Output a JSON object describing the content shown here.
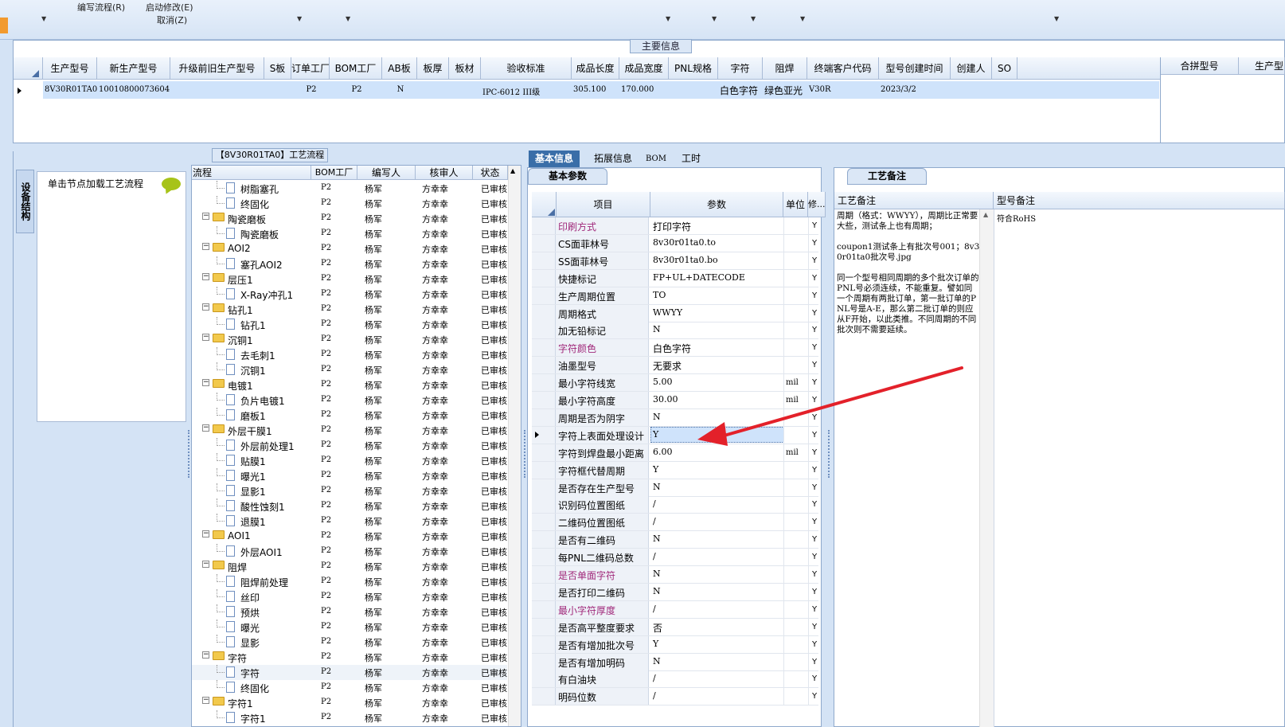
{
  "toolbar": {
    "write_flow": "编写流程(R)",
    "start_modify": "启动修改(E)",
    "cancel": "取消(Z)"
  },
  "main_info": {
    "title": "主要信息",
    "columns": [
      "生产型号",
      "新生产型号",
      "升级前旧生产型号",
      "S板",
      "订单工厂",
      "BOM工厂",
      "AB板",
      "板厚",
      "板材",
      "验收标准",
      "成品长度",
      "成品宽度",
      "PNL规格",
      "字符",
      "阻焊",
      "终端客户代码",
      "型号创建时间",
      "创建人",
      "SO"
    ],
    "row": [
      "8V30R01TA0",
      "10010800073604",
      "",
      "",
      "P2",
      "P2",
      "N",
      "",
      "",
      "IPC-6012 III级",
      "305.100",
      "170.000",
      "",
      "白色字符",
      "绿色亚光",
      "V30R",
      "2023/3/2",
      "",
      ""
    ],
    "merge_columns": [
      "合拼型号",
      "生产型"
    ]
  },
  "nav": {
    "vertical_tab": "设备结构",
    "hint": "单击节点加载工艺流程"
  },
  "tree": {
    "title": "【8V30R01TA0】工艺流程",
    "columns": [
      "流程",
      "BOM工厂",
      "编写人",
      "核审人",
      "状态"
    ],
    "rows": [
      {
        "level": 2,
        "type": "file",
        "name": "树脂塞孔",
        "bom": "P2",
        "writer": "杨军",
        "reviewer": "方幸幸",
        "status": "已审核"
      },
      {
        "level": 2,
        "type": "file",
        "name": "终固化",
        "bom": "P2",
        "writer": "杨军",
        "reviewer": "方幸幸",
        "status": "已审核"
      },
      {
        "level": 1,
        "type": "folder",
        "name": "陶瓷磨板",
        "bom": "P2",
        "writer": "杨军",
        "reviewer": "方幸幸",
        "status": "已审核"
      },
      {
        "level": 2,
        "type": "file",
        "name": "陶瓷磨板",
        "bom": "P2",
        "writer": "杨军",
        "reviewer": "方幸幸",
        "status": "已审核"
      },
      {
        "level": 1,
        "type": "folder",
        "name": "AOI2",
        "bom": "P2",
        "writer": "杨军",
        "reviewer": "方幸幸",
        "status": "已审核"
      },
      {
        "level": 2,
        "type": "file",
        "name": "塞孔AOI2",
        "bom": "P2",
        "writer": "杨军",
        "reviewer": "方幸幸",
        "status": "已审核"
      },
      {
        "level": 1,
        "type": "folder",
        "name": "层压1",
        "bom": "P2",
        "writer": "杨军",
        "reviewer": "方幸幸",
        "status": "已审核"
      },
      {
        "level": 2,
        "type": "file",
        "name": "X-Ray冲孔1",
        "bom": "P2",
        "writer": "杨军",
        "reviewer": "方幸幸",
        "status": "已审核"
      },
      {
        "level": 1,
        "type": "folder",
        "name": "钻孔1",
        "bom": "P2",
        "writer": "杨军",
        "reviewer": "方幸幸",
        "status": "已审核"
      },
      {
        "level": 2,
        "type": "file",
        "name": "钻孔1",
        "bom": "P2",
        "writer": "杨军",
        "reviewer": "方幸幸",
        "status": "已审核"
      },
      {
        "level": 1,
        "type": "folder",
        "name": "沉铜1",
        "bom": "P2",
        "writer": "杨军",
        "reviewer": "方幸幸",
        "status": "已审核"
      },
      {
        "level": 2,
        "type": "file",
        "name": "去毛刺1",
        "bom": "P2",
        "writer": "杨军",
        "reviewer": "方幸幸",
        "status": "已审核"
      },
      {
        "level": 2,
        "type": "file",
        "name": "沉铜1",
        "bom": "P2",
        "writer": "杨军",
        "reviewer": "方幸幸",
        "status": "已审核"
      },
      {
        "level": 1,
        "type": "folder",
        "name": "电镀1",
        "bom": "P2",
        "writer": "杨军",
        "reviewer": "方幸幸",
        "status": "已审核"
      },
      {
        "level": 2,
        "type": "file",
        "name": "负片电镀1",
        "bom": "P2",
        "writer": "杨军",
        "reviewer": "方幸幸",
        "status": "已审核"
      },
      {
        "level": 2,
        "type": "file",
        "name": "磨板1",
        "bom": "P2",
        "writer": "杨军",
        "reviewer": "方幸幸",
        "status": "已审核"
      },
      {
        "level": 1,
        "type": "folder",
        "name": "外层干膜1",
        "bom": "P2",
        "writer": "杨军",
        "reviewer": "方幸幸",
        "status": "已审核"
      },
      {
        "level": 2,
        "type": "file",
        "name": "外层前处理1",
        "bom": "P2",
        "writer": "杨军",
        "reviewer": "方幸幸",
        "status": "已审核"
      },
      {
        "level": 2,
        "type": "file",
        "name": "贴膜1",
        "bom": "P2",
        "writer": "杨军",
        "reviewer": "方幸幸",
        "status": "已审核"
      },
      {
        "level": 2,
        "type": "file",
        "name": "曝光1",
        "bom": "P2",
        "writer": "杨军",
        "reviewer": "方幸幸",
        "status": "已审核"
      },
      {
        "level": 2,
        "type": "file",
        "name": "显影1",
        "bom": "P2",
        "writer": "杨军",
        "reviewer": "方幸幸",
        "status": "已审核"
      },
      {
        "level": 2,
        "type": "file",
        "name": "酸性蚀刻1",
        "bom": "P2",
        "writer": "杨军",
        "reviewer": "方幸幸",
        "status": "已审核"
      },
      {
        "level": 2,
        "type": "file",
        "name": "退膜1",
        "bom": "P2",
        "writer": "杨军",
        "reviewer": "方幸幸",
        "status": "已审核"
      },
      {
        "level": 1,
        "type": "folder",
        "name": "AOI1",
        "bom": "P2",
        "writer": "杨军",
        "reviewer": "方幸幸",
        "status": "已审核"
      },
      {
        "level": 2,
        "type": "file",
        "name": "外层AOI1",
        "bom": "P2",
        "writer": "杨军",
        "reviewer": "方幸幸",
        "status": "已审核"
      },
      {
        "level": 1,
        "type": "folder",
        "name": "阻焊",
        "bom": "P2",
        "writer": "杨军",
        "reviewer": "方幸幸",
        "status": "已审核"
      },
      {
        "level": 2,
        "type": "file",
        "name": "阻焊前处理",
        "bom": "P2",
        "writer": "杨军",
        "reviewer": "方幸幸",
        "status": "已审核"
      },
      {
        "level": 2,
        "type": "file",
        "name": "丝印",
        "bom": "P2",
        "writer": "杨军",
        "reviewer": "方幸幸",
        "status": "已审核"
      },
      {
        "level": 2,
        "type": "file",
        "name": "预烘",
        "bom": "P2",
        "writer": "杨军",
        "reviewer": "方幸幸",
        "status": "已审核"
      },
      {
        "level": 2,
        "type": "file",
        "name": "曝光",
        "bom": "P2",
        "writer": "杨军",
        "reviewer": "方幸幸",
        "status": "已审核"
      },
      {
        "level": 2,
        "type": "file",
        "name": "显影",
        "bom": "P2",
        "writer": "杨军",
        "reviewer": "方幸幸",
        "status": "已审核"
      },
      {
        "level": 1,
        "type": "folder",
        "name": "字符",
        "bom": "P2",
        "writer": "杨军",
        "reviewer": "方幸幸",
        "status": "已审核"
      },
      {
        "level": 2,
        "type": "file",
        "name": "字符",
        "bom": "P2",
        "writer": "杨军",
        "reviewer": "方幸幸",
        "status": "已审核",
        "selected": true
      },
      {
        "level": 2,
        "type": "file",
        "name": "终固化",
        "bom": "P2",
        "writer": "杨军",
        "reviewer": "方幸幸",
        "status": "已审核"
      },
      {
        "level": 1,
        "type": "folder",
        "name": "字符1",
        "bom": "P2",
        "writer": "杨军",
        "reviewer": "方幸幸",
        "status": "已审核"
      },
      {
        "level": 2,
        "type": "file",
        "name": "字符1",
        "bom": "P2",
        "writer": "杨军",
        "reviewer": "方幸幸",
        "status": "已审核"
      }
    ]
  },
  "tabs": [
    "基本信息",
    "拓展信息",
    "BOM",
    "工时"
  ],
  "params": {
    "title": "基本参数",
    "columns": [
      "项目",
      "参数",
      "单位",
      "修..."
    ],
    "rows": [
      {
        "name": "印刷方式",
        "value": "打印字符",
        "unit": "",
        "mod": "Y",
        "highlight": true
      },
      {
        "name": "CS面菲林号",
        "value": "8v30r01ta0.to",
        "unit": "",
        "mod": "Y"
      },
      {
        "name": "SS面菲林号",
        "value": "8v30r01ta0.bo",
        "unit": "",
        "mod": "Y"
      },
      {
        "name": "快捷标记",
        "value": "FP+UL+DATECODE",
        "unit": "",
        "mod": "Y"
      },
      {
        "name": "生产周期位置",
        "value": "TO",
        "unit": "",
        "mod": "Y"
      },
      {
        "name": "周期格式",
        "value": "WWYY",
        "unit": "",
        "mod": "Y"
      },
      {
        "name": "加无铅标记",
        "value": "N",
        "unit": "",
        "mod": "Y"
      },
      {
        "name": "字符颜色",
        "value": "白色字符",
        "unit": "",
        "mod": "Y",
        "highlight": true
      },
      {
        "name": "油墨型号",
        "value": "无要求",
        "unit": "",
        "mod": "Y"
      },
      {
        "name": "最小字符线宽",
        "value": "5.00",
        "unit": "mil",
        "mod": "Y"
      },
      {
        "name": "最小字符高度",
        "value": "30.00",
        "unit": "mil",
        "mod": "Y"
      },
      {
        "name": "周期是否为阴字",
        "value": "N",
        "unit": "",
        "mod": "Y"
      },
      {
        "name": "字符上表面处理设计",
        "value": "Y",
        "unit": "",
        "mod": "Y",
        "selected": true
      },
      {
        "name": "字符到焊盘最小距离",
        "value": "6.00",
        "unit": "mil",
        "mod": "Y"
      },
      {
        "name": "字符框代替周期",
        "value": "Y",
        "unit": "",
        "mod": "Y"
      },
      {
        "name": "是否存在生产型号",
        "value": "N",
        "unit": "",
        "mod": "Y"
      },
      {
        "name": "识别码位置图纸",
        "value": "/",
        "unit": "",
        "mod": "Y"
      },
      {
        "name": "二维码位置图纸",
        "value": "/",
        "unit": "",
        "mod": "Y"
      },
      {
        "name": "是否有二维码",
        "value": "N",
        "unit": "",
        "mod": "Y"
      },
      {
        "name": "每PNL二维码总数",
        "value": "/",
        "unit": "",
        "mod": "Y"
      },
      {
        "name": "是否单面字符",
        "value": "N",
        "unit": "",
        "mod": "Y",
        "highlight": true
      },
      {
        "name": "是否打印二维码",
        "value": "N",
        "unit": "",
        "mod": "Y"
      },
      {
        "name": "最小字符厚度",
        "value": "/",
        "unit": "",
        "mod": "Y",
        "highlight": true
      },
      {
        "name": "是否高平整度要求",
        "value": "否",
        "unit": "",
        "mod": "Y"
      },
      {
        "name": "是否有增加批次号",
        "value": "Y",
        "unit": "",
        "mod": "Y"
      },
      {
        "name": "是否有增加明码",
        "value": "N",
        "unit": "",
        "mod": "Y"
      },
      {
        "name": "有白油块",
        "value": "/",
        "unit": "",
        "mod": "Y"
      },
      {
        "name": "明码位数",
        "value": "/",
        "unit": "",
        "mod": "Y"
      }
    ]
  },
  "remarks": {
    "title": "工艺备注",
    "columns": [
      "工艺备注",
      "型号备注"
    ],
    "process_remark": "周期（格式：WWYY），周期比正常要大些，测试条上也有周期；\n\ncoupon1测试条上有批次号001；8v30r01ta0批次号.jpg\n\n同一个型号相同周期的多个批次订单的PNL号必须连续，不能重复。譬如同一个周期有两批订单，第一批订单的PNL号是A-E，那么第二批订单的则应从F开始，以此类推。不同周期的不同批次则不需要延续。",
    "model_remark": "符合RoHS"
  },
  "colors": {
    "accent": "#3a6ea8",
    "highlight_text": "#a0287a",
    "selection": "#cfe3fb",
    "arrow": "#e3212a"
  }
}
